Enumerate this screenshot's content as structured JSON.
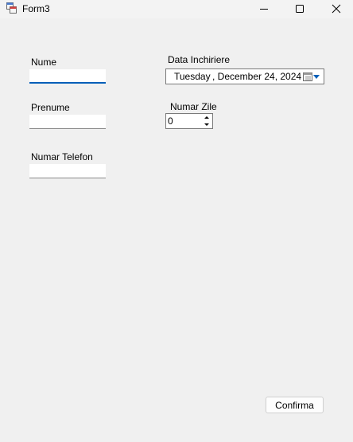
{
  "window": {
    "title": "Form3"
  },
  "titlebar": {
    "minimize_icon": "minimize-icon",
    "maximize_icon": "maximize-icon",
    "close_icon": "close-icon"
  },
  "form": {
    "nume_label": "Nume",
    "nume_value": "",
    "prenume_label": "Prenume",
    "prenume_value": "",
    "telefon_label": "Numar Telefon",
    "telefon_value": "",
    "data_label": "Data Inchiriere",
    "data_day": "Tuesday",
    "data_date": ", December 24, 2024",
    "zile_label": "Numar Zile",
    "zile_value": "0",
    "confirm_label": "Confirma"
  },
  "colors": {
    "accent": "#005fb8",
    "background": "#f0f0f0"
  }
}
